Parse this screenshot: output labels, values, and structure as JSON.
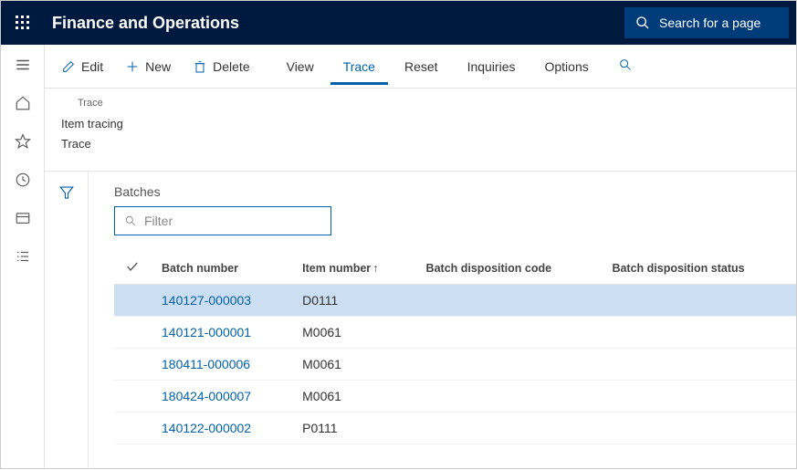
{
  "app_title": "Finance and Operations",
  "search_placeholder": "Search for a page",
  "actions": {
    "edit": "Edit",
    "new": "New",
    "delete": "Delete"
  },
  "tabs": {
    "view": "View",
    "trace": "Trace",
    "reset": "Reset",
    "inquiries": "Inquiries",
    "options": "Options"
  },
  "breadcrumb": "Trace",
  "context": {
    "line1": "Item tracing",
    "line2": "Trace"
  },
  "grid": {
    "title": "Batches",
    "filter_placeholder": "Filter",
    "columns": {
      "batch_number": "Batch number",
      "item_number": "Item number",
      "disposition_code": "Batch disposition code",
      "disposition_status": "Batch disposition status"
    },
    "rows": [
      {
        "batch": "140127-000003",
        "item": "D0111",
        "code": "",
        "status": "",
        "selected": true
      },
      {
        "batch": "140121-000001",
        "item": "M0061",
        "code": "",
        "status": "",
        "selected": false
      },
      {
        "batch": "180411-000006",
        "item": "M0061",
        "code": "",
        "status": "",
        "selected": false
      },
      {
        "batch": "180424-000007",
        "item": "M0061",
        "code": "",
        "status": "",
        "selected": false
      },
      {
        "batch": "140122-000002",
        "item": "P0111",
        "code": "",
        "status": "",
        "selected": false
      }
    ]
  }
}
